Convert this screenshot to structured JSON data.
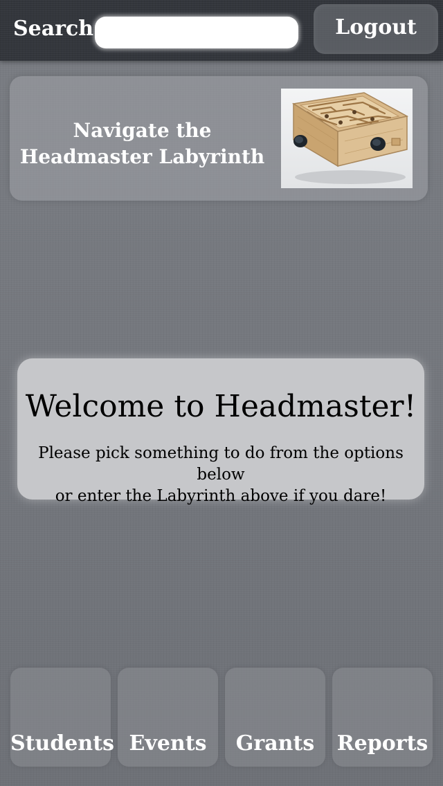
{
  "header": {
    "search_label": "Search",
    "search_placeholder": "",
    "search_value": "",
    "logout_label": "Logout"
  },
  "labyrinth": {
    "title_line1": "Navigate the",
    "title_line2": "Headmaster Labyrinth",
    "image": "wooden-labyrinth-maze-icon"
  },
  "welcome": {
    "heading": "Welcome to Headmaster!",
    "line1": "Please pick something to do from the options below",
    "line2": "or enter the Labyrinth above if you dare!"
  },
  "nav": {
    "items": [
      {
        "label": "Students"
      },
      {
        "label": "Events"
      },
      {
        "label": "Grants"
      },
      {
        "label": "Reports"
      }
    ]
  },
  "colors": {
    "background": "#707379",
    "topbar": "#33363c",
    "welcome_card": "#c6c7ca",
    "text_light": "#ffffff",
    "text_dark": "#000000"
  }
}
